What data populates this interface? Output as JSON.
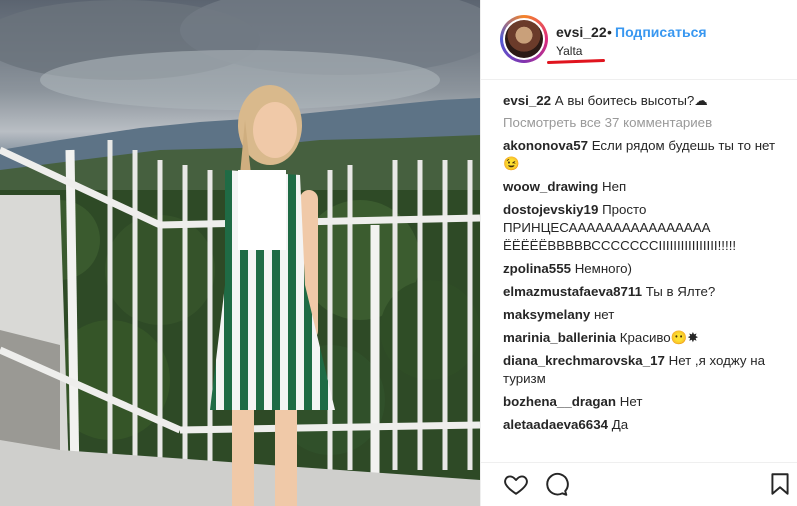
{
  "post": {
    "username": "evsi_22",
    "separator": "•",
    "follow_label": "Подписаться",
    "location": "Yalta"
  },
  "caption": {
    "username": "evsi_22",
    "text": "А вы боитесь высоты?☁"
  },
  "view_all_comments": "Посмотреть все 37 комментариев",
  "comments": [
    {
      "user": "akononova57",
      "text": "Если рядом будешь ты то нет😉"
    },
    {
      "user": "woow_drawing",
      "text": "Неп"
    },
    {
      "user": "dostojevskiy19",
      "text": "Просто ПРИНЦЕСАААААААААААААААА ЁЁЁЁЁВВВВВСССССССIIIIIIIIIIIIIIII!!!!!"
    },
    {
      "user": "zpolina555",
      "text": "Немного)"
    },
    {
      "user": "elmazmustafaeva8711",
      "text": "Ты в Ялте?"
    },
    {
      "user": "maksymelany",
      "text": "нет"
    },
    {
      "user": "marinia_ballerinia",
      "text": "Красиво😶✸"
    },
    {
      "user": "diana_krechmarovska_17",
      "text": "Нет ,я ходжу на туризм"
    },
    {
      "user": "bozhena__dragan",
      "text": "Нет"
    },
    {
      "user": "aletaadaeva6634",
      "text": "Да"
    }
  ],
  "icons": {
    "like": "heart-icon",
    "comment": "comment-icon",
    "save": "bookmark-icon"
  },
  "colors": {
    "follow": "#3897f0",
    "annotation": "#e0141e"
  }
}
